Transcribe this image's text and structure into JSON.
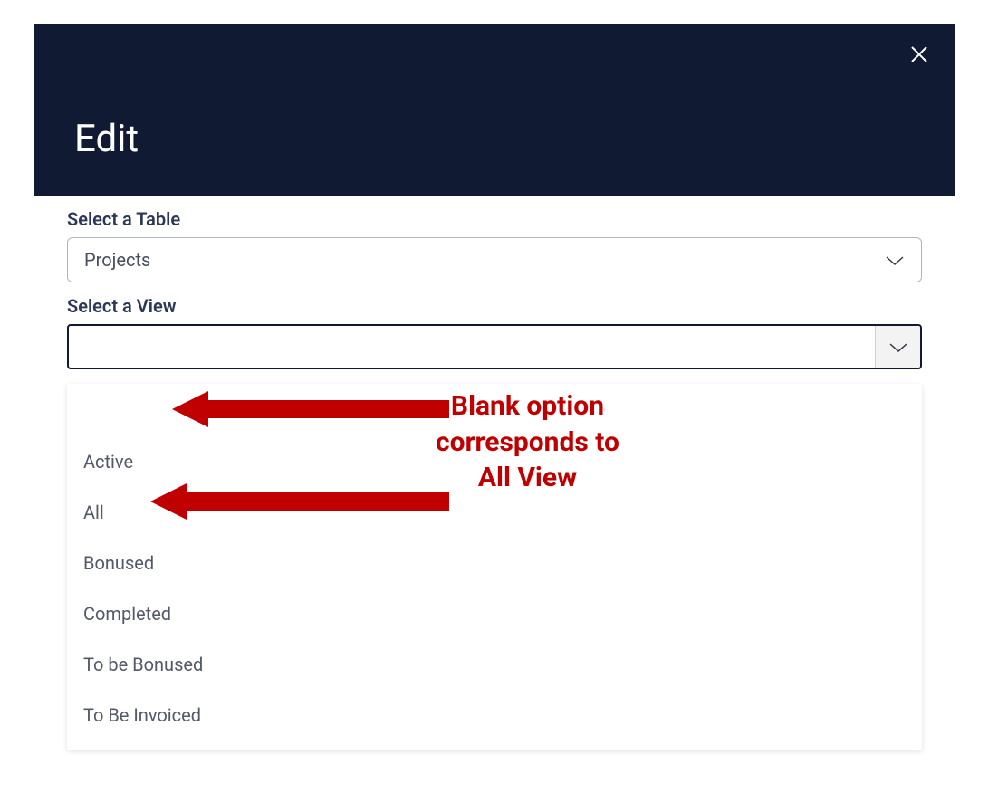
{
  "header": {
    "title": "Edit"
  },
  "form": {
    "table_label": "Select a Table",
    "table_value": "Projects",
    "view_label": "Select a View",
    "view_value": ""
  },
  "dropdown": {
    "options": [
      {
        "label": ""
      },
      {
        "label": "Active"
      },
      {
        "label": "All"
      },
      {
        "label": "Bonused"
      },
      {
        "label": "Completed"
      },
      {
        "label": "To be Bonused"
      },
      {
        "label": "To Be Invoiced"
      }
    ]
  },
  "annotation": {
    "line1": "Blank option",
    "line2": "corresponds to",
    "line3": "All View"
  },
  "colors": {
    "header_bg": "#111a33",
    "annotation_red": "#c00000",
    "text_muted": "#535968"
  }
}
